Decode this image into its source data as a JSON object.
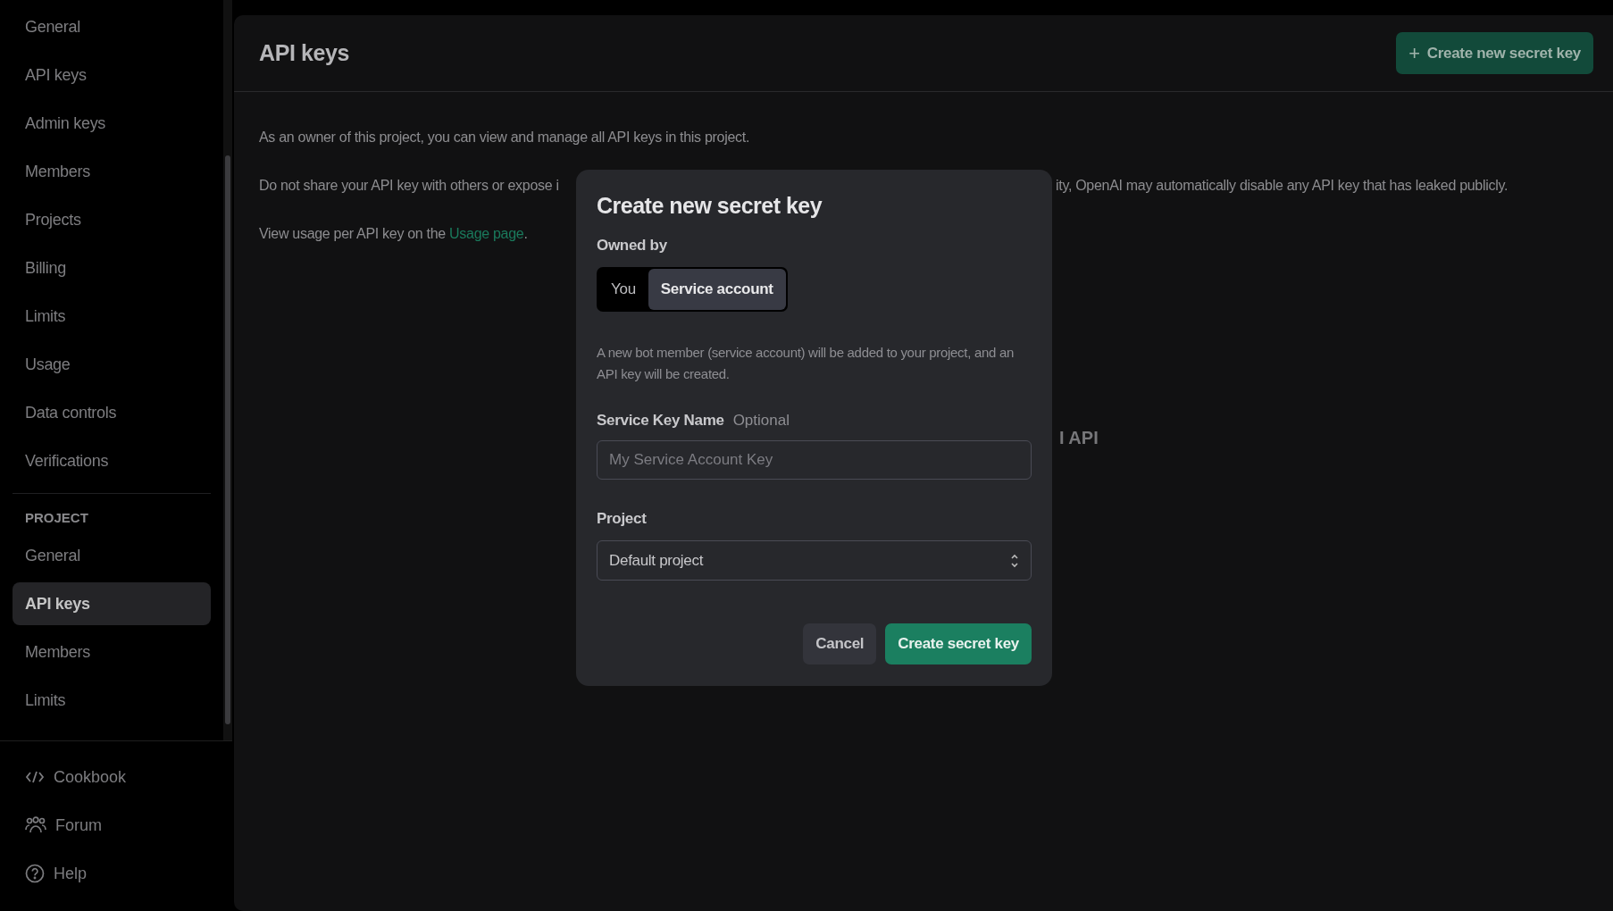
{
  "sidebar": {
    "organization_items": [
      {
        "label": "General",
        "selected": false
      },
      {
        "label": "API keys",
        "selected": false
      },
      {
        "label": "Admin keys",
        "selected": false
      },
      {
        "label": "Members",
        "selected": false
      },
      {
        "label": "Projects",
        "selected": false
      },
      {
        "label": "Billing",
        "selected": false
      },
      {
        "label": "Limits",
        "selected": false
      },
      {
        "label": "Usage",
        "selected": false
      },
      {
        "label": "Data controls",
        "selected": false
      },
      {
        "label": "Verifications",
        "selected": false
      }
    ],
    "project_heading": "PROJECT",
    "project_items": [
      {
        "label": "General",
        "selected": false
      },
      {
        "label": "API keys",
        "selected": true
      },
      {
        "label": "Members",
        "selected": false
      },
      {
        "label": "Limits",
        "selected": false
      }
    ],
    "footer_links": [
      {
        "label": "Cookbook",
        "kind": "code"
      },
      {
        "label": "Forum",
        "kind": "people"
      },
      {
        "label": "Help",
        "kind": "help"
      }
    ]
  },
  "header": {
    "title": "API keys",
    "button": {
      "icon": "+",
      "label": "Create new secret key"
    }
  },
  "content": {
    "intro": "As an owner of this project, you can view and manage all API keys in this project.",
    "warning_start": "Do not share your API key with others or expose i",
    "warning_end": "ity, OpenAI may automatically disable any API key that has leaked publicly.",
    "usage_text": "View usage per API key on the ",
    "usage_link": "Usage page",
    "usage_end": ".",
    "empty_heading": "I API"
  },
  "dialog": {
    "title": "Create new secret key",
    "owned_by_label": "Owned by",
    "owner_options": [
      {
        "label": "You",
        "selected": false
      },
      {
        "label": "Service account",
        "selected": true
      }
    ],
    "description": "A new bot member (service account) will be added to your project, and an API key will be created.",
    "name_label": "Service Key Name",
    "name_hint": "Optional",
    "name_field": {
      "placeholder": "My Service Account Key"
    },
    "project_label": "Project",
    "project_select": {
      "value": "Default project"
    },
    "buttons": [
      {
        "label": "Cancel",
        "kind": "secondary"
      },
      {
        "label": "Create secret key",
        "kind": "primary"
      }
    ]
  }
}
